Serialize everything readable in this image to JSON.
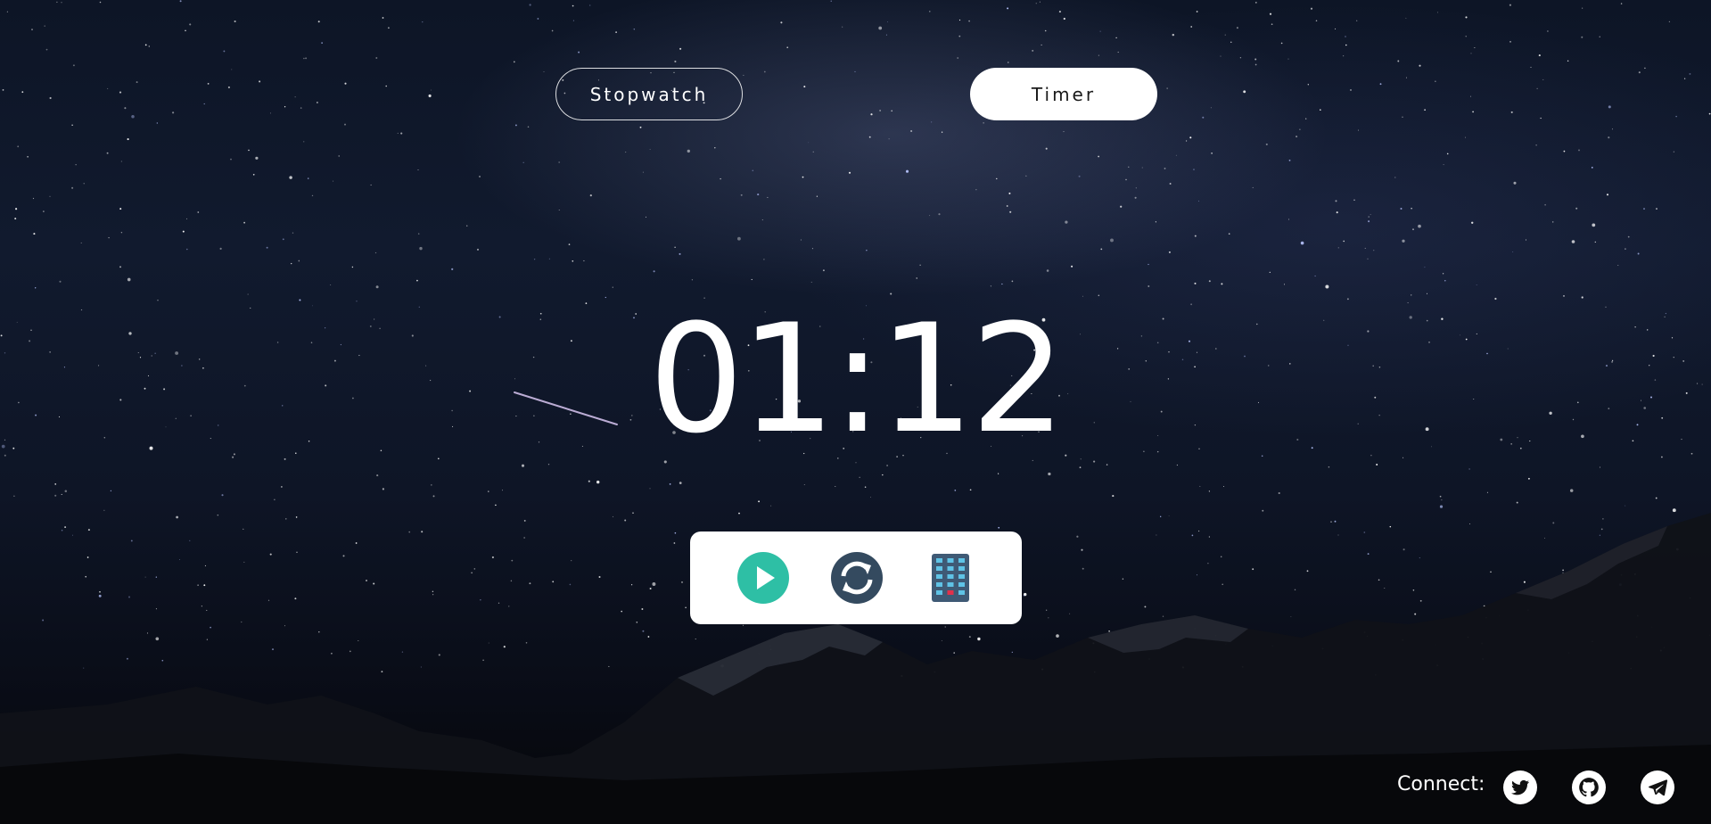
{
  "modes": {
    "stopwatch_label": "Stopwatch",
    "timer_label": "Timer",
    "active": "Timer"
  },
  "timer": {
    "display": "01:12"
  },
  "controls": {
    "play_icon": "play-icon",
    "reset_icon": "reset-icon",
    "keypad_icon": "keypad-icon"
  },
  "footer": {
    "connect_label": "Connect:",
    "social": [
      "twitter-icon",
      "github-icon",
      "telegram-icon"
    ]
  },
  "colors": {
    "play_green": "#2ebfa5",
    "reset_dark": "#344a5f",
    "keypad_body": "#3f5a75",
    "keypad_keys": "#5fc3e6",
    "keypad_red": "#e3314b",
    "white": "#ffffff"
  }
}
